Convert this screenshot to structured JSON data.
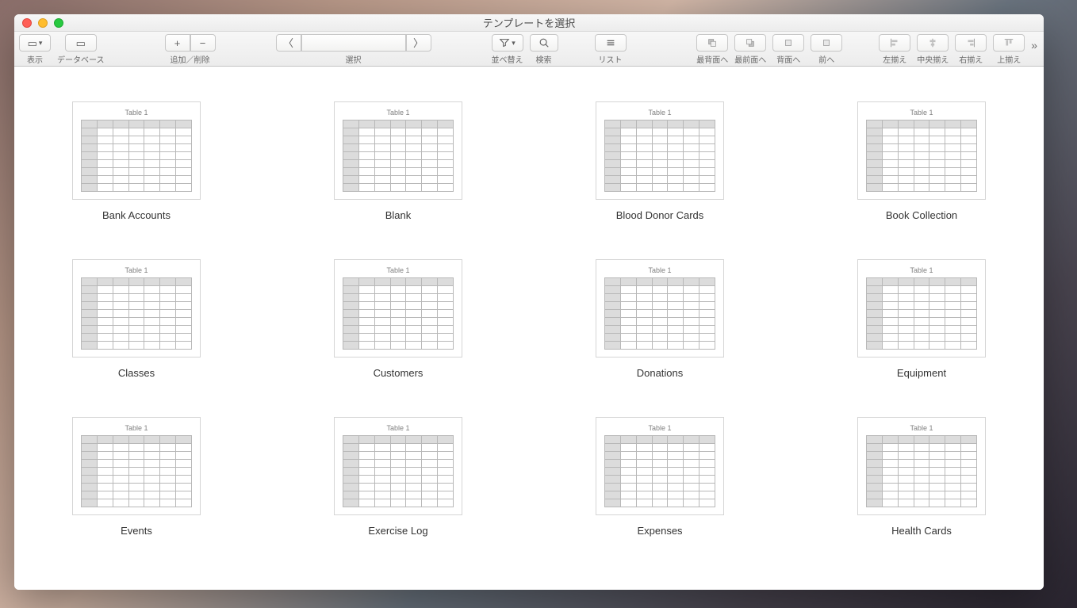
{
  "window": {
    "title": "テンプレートを選択"
  },
  "toolbar": {
    "view_label": "表示",
    "database_label": "データベース",
    "addremove_label": "追加／削除",
    "selection_label": "選択",
    "sort_label": "並べ替え",
    "search_label": "検索",
    "list_label": "リスト",
    "arr_back_label": "最背面へ",
    "arr_front_label": "最前面へ",
    "arr_backward_label": "背面へ",
    "arr_forward_label": "前へ",
    "align_left_label": "左揃え",
    "align_center_label": "中央揃え",
    "align_right_label": "右揃え",
    "align_top_label": "上揃え"
  },
  "thumb": {
    "table_caption": "Table 1"
  },
  "templates": [
    {
      "label": "Bank Accounts"
    },
    {
      "label": "Blank"
    },
    {
      "label": "Blood Donor Cards"
    },
    {
      "label": "Book Collection"
    },
    {
      "label": "Classes"
    },
    {
      "label": "Customers"
    },
    {
      "label": "Donations"
    },
    {
      "label": "Equipment"
    },
    {
      "label": "Events"
    },
    {
      "label": "Exercise Log"
    },
    {
      "label": "Expenses"
    },
    {
      "label": "Health Cards"
    }
  ]
}
